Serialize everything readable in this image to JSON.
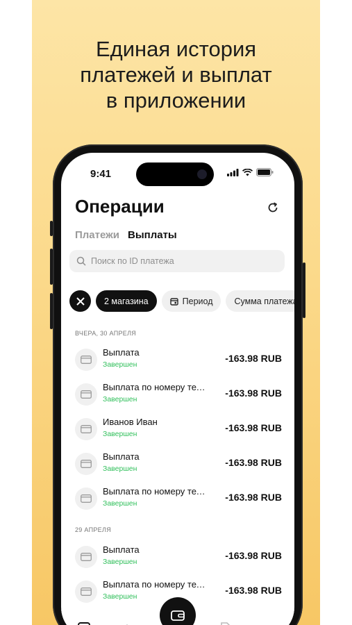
{
  "promo": {
    "headline_lines": [
      "Единая история",
      "платежей и выплат",
      "в приложении"
    ]
  },
  "status_bar": {
    "time": "9:41"
  },
  "screen": {
    "title": "Операции",
    "tabs": [
      {
        "label": "Платежи",
        "active": false
      },
      {
        "label": "Выплаты",
        "active": true
      }
    ],
    "search": {
      "placeholder": "Поиск по ID платежа"
    },
    "filters": {
      "clear_icon": "close-icon",
      "chips": [
        {
          "label": "2 магазина",
          "selected": true
        },
        {
          "label": "Период",
          "icon": "calendar-icon",
          "selected": false
        },
        {
          "label": "Сумма платежа",
          "selected": false
        }
      ]
    },
    "sections": [
      {
        "header": "ВЧЕРА, 30 АПРЕЛЯ",
        "items": [
          {
            "name": "Выплата",
            "status": "Завершен",
            "amount": "-163.98 RUB"
          },
          {
            "name": "Выплата по номеру телефона",
            "status": "Завершен",
            "amount": "-163.98 RUB"
          },
          {
            "name": "Иванов Иван",
            "status": "Завершен",
            "amount": "-163.98 RUB"
          },
          {
            "name": "Выплата",
            "status": "Завершен",
            "amount": "-163.98 RUB"
          },
          {
            "name": "Выплата по номеру телефона",
            "status": "Завершен",
            "amount": "-163.98 RUB"
          }
        ]
      },
      {
        "header": "29 АПРЕЛЯ",
        "items": [
          {
            "name": "Выплата",
            "status": "Завершен",
            "amount": "-163.98 RUB"
          },
          {
            "name": "Выплата по номеру телефона",
            "status": "Завершен",
            "amount": "-163.98 RUB"
          }
        ]
      }
    ]
  },
  "colors": {
    "accent_dark": "#111111",
    "status_green": "#2fbf5a",
    "banner_top": "#fde5a6",
    "banner_bottom": "#f7c765"
  }
}
